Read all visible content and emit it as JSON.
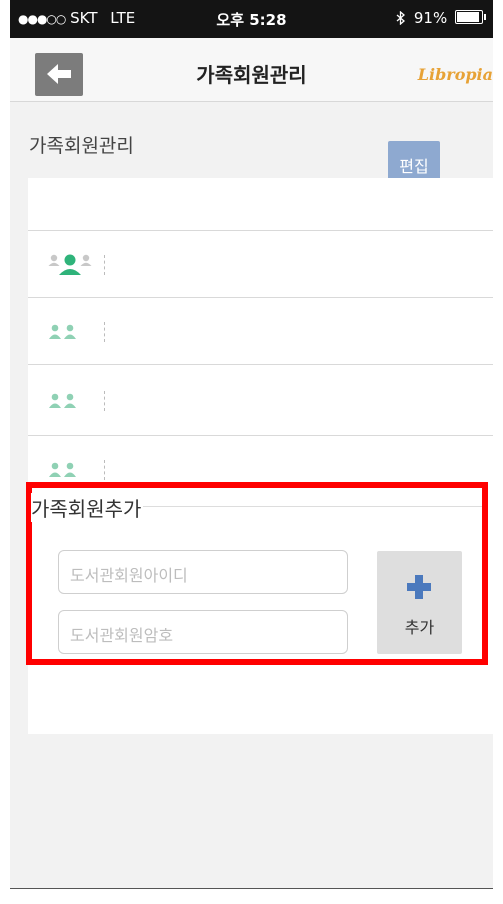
{
  "status_bar": {
    "carrier": "SKT",
    "network": "LTE",
    "time": "오후 5:28",
    "battery": "91%"
  },
  "nav": {
    "title": "가족회원관리",
    "logo": "Libropia"
  },
  "section": {
    "title": "가족회원관리",
    "edit_label": "편집"
  },
  "members": [
    {
      "name": "",
      "selected": true
    },
    {
      "name": "",
      "selected": false
    },
    {
      "name": "",
      "selected": false
    },
    {
      "name": "",
      "selected": false
    }
  ],
  "add_panel": {
    "title": "가족회원추가",
    "id_placeholder": "도서관회원아이디",
    "password_placeholder": "도서관회원암호",
    "add_label": "추가"
  },
  "colors": {
    "accent_green": "#2fb37a",
    "light_green": "#8fd1b4",
    "edit_blue": "#8ea9d0",
    "plus_blue": "#4b79bd",
    "logo_orange": "#e7a236",
    "highlight_red": "#ff0000"
  }
}
